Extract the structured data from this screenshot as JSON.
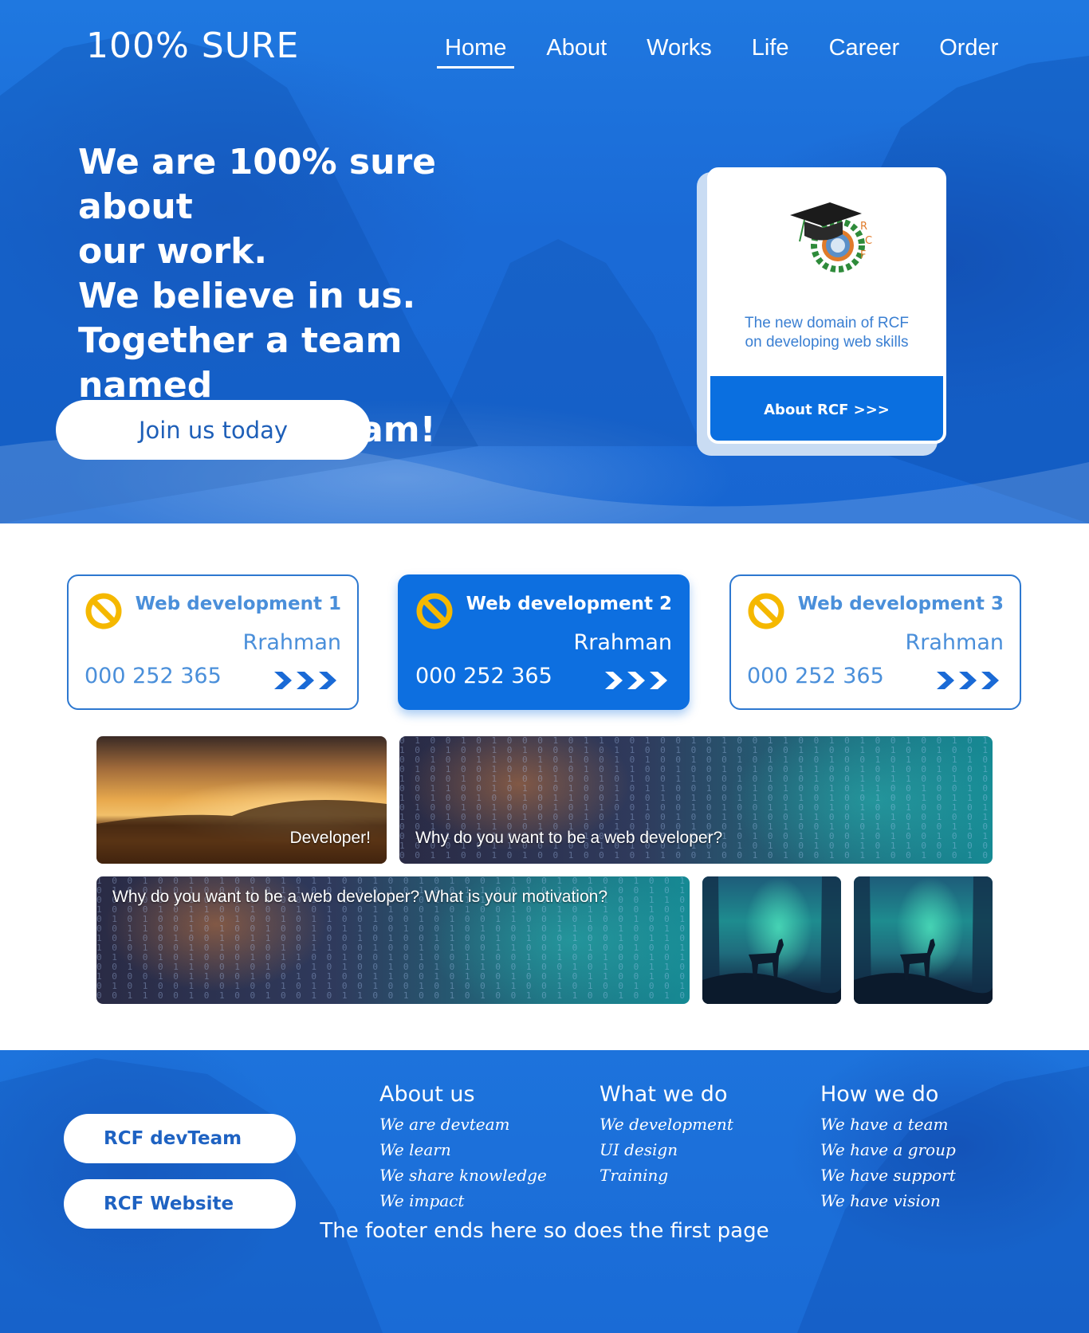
{
  "brand": {
    "logo": "100% SURE"
  },
  "nav": [
    {
      "label": "Home",
      "active": true
    },
    {
      "label": "About",
      "active": false
    },
    {
      "label": "Works",
      "active": false
    },
    {
      "label": "Life",
      "active": false
    },
    {
      "label": "Career",
      "active": false
    },
    {
      "label": "Order",
      "active": false
    }
  ],
  "hero": {
    "headline": "We are 100% sure about\nour work.\nWe believe in us.\nTogether a team named\nthe RCF devTeam!",
    "cta": "Join us today"
  },
  "rcf_card": {
    "logo_letters": [
      "R",
      "C",
      "F"
    ],
    "text": "The new domain of RCF\non developing web skills",
    "button": "About RCF >>>"
  },
  "services": [
    {
      "title": "Web development 1",
      "name": "Rrahman",
      "phone": "000 252 365",
      "active": false
    },
    {
      "title": "Web development 2",
      "name": "Rrahman",
      "phone": "000 252 365",
      "active": true
    },
    {
      "title": "Web development 3",
      "name": "Rrahman",
      "phone": "000 252 365",
      "active": false
    }
  ],
  "gallery": {
    "tile1": "Developer!",
    "tile2": "Why do you want to be a web developer?",
    "tile3": "Why do you want to be a web developer? What is your motivation?"
  },
  "footer": {
    "buttons": [
      "RCF devTeam",
      "RCF Website"
    ],
    "columns": [
      {
        "heading": "About us",
        "links": [
          "We are devteam",
          "We learn",
          "We share knowledge",
          "We impact"
        ]
      },
      {
        "heading": "What we do",
        "links": [
          "We development",
          "UI design",
          "Training"
        ]
      },
      {
        "heading": "How we do",
        "links": [
          "We have a team",
          "We have a group",
          "We have support",
          "We have vision"
        ]
      }
    ],
    "end_text": "The footer ends here so does the first page"
  },
  "colors": {
    "primary": "#0d6fe0",
    "hero_blue": "#1a6ad6",
    "warning_yellow": "#f5b800",
    "text_blue": "#4a8fda"
  },
  "icons": {
    "service": "ban-icon",
    "more": "triple-chevron-right-icon"
  }
}
